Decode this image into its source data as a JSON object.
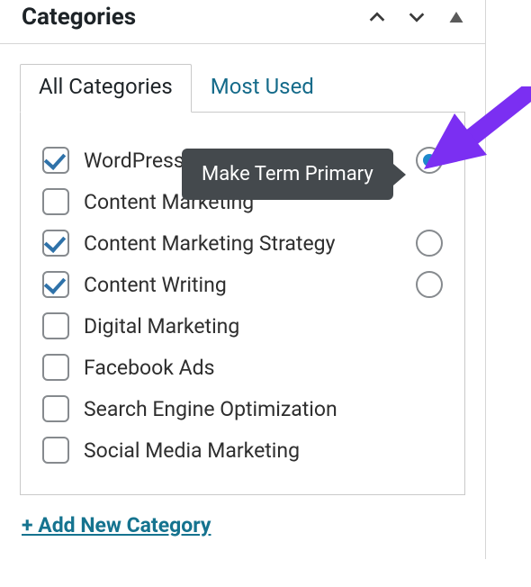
{
  "panel": {
    "title": "Categories"
  },
  "tabs": {
    "all": "All Categories",
    "most_used": "Most Used"
  },
  "tooltip": {
    "text": "Make Term Primary"
  },
  "categories": [
    {
      "label": "WordPress",
      "checked": true,
      "primaryVisible": true,
      "primarySelected": true
    },
    {
      "label": "Content Marketing",
      "checked": false,
      "primaryVisible": false,
      "primarySelected": false
    },
    {
      "label": "Content Marketing Strategy",
      "checked": true,
      "primaryVisible": true,
      "primarySelected": false
    },
    {
      "label": "Content Writing",
      "checked": true,
      "primaryVisible": true,
      "primarySelected": false
    },
    {
      "label": "Digital Marketing",
      "checked": false,
      "primaryVisible": false,
      "primarySelected": false
    },
    {
      "label": "Facebook Ads",
      "checked": false,
      "primaryVisible": false,
      "primarySelected": false
    },
    {
      "label": "Search Engine Optimization",
      "checked": false,
      "primaryVisible": false,
      "primarySelected": false
    },
    {
      "label": "Social Media Marketing",
      "checked": false,
      "primaryVisible": false,
      "primarySelected": false
    }
  ],
  "actions": {
    "add_new": "+ Add New Category"
  },
  "colors": {
    "link": "#15738f",
    "check": "#2f72a9",
    "tooltip_bg": "#44494d",
    "arrow": "#7b2ff2"
  }
}
